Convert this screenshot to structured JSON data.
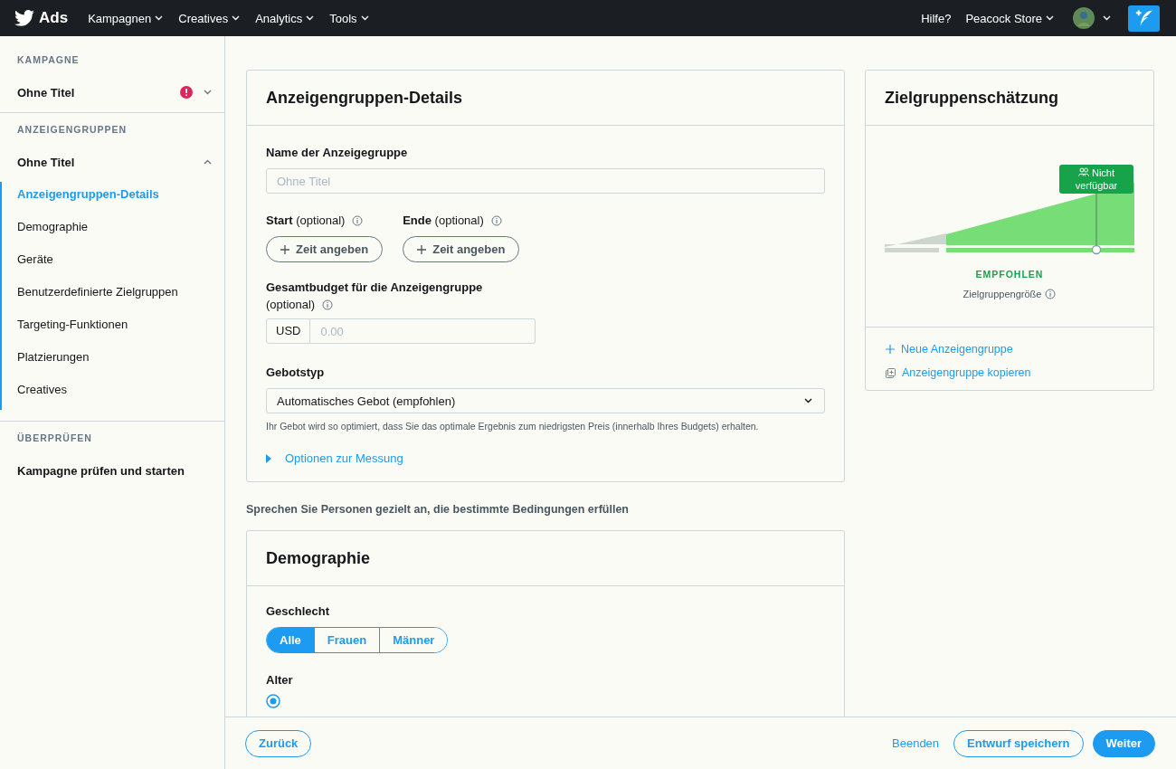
{
  "topbar": {
    "brand": "Ads",
    "nav": [
      {
        "label": "Kampagnen"
      },
      {
        "label": "Creatives"
      },
      {
        "label": "Analytics"
      },
      {
        "label": "Tools"
      }
    ],
    "help": "Hilfe?",
    "account": "Peacock Store"
  },
  "sidebar": {
    "sections": [
      {
        "heading": "KAMPAGNE",
        "title": "Ohne Titel",
        "error": true,
        "expanded": false
      },
      {
        "heading": "ANZEIGENGRUPPEN",
        "title": "Ohne Titel",
        "error": false,
        "expanded": true,
        "items": [
          {
            "label": "Anzeigengruppen-Details",
            "selected": true
          },
          {
            "label": "Demographie",
            "selected": false
          },
          {
            "label": "Geräte",
            "selected": false
          },
          {
            "label": "Benutzerdefinierte Zielgruppen",
            "selected": false
          },
          {
            "label": "Targeting-Funktionen",
            "selected": false
          },
          {
            "label": "Platzierungen",
            "selected": false
          },
          {
            "label": "Creatives",
            "selected": false
          }
        ]
      },
      {
        "heading": "ÜBERPRÜFEN",
        "title": "Kampagne prüfen und starten",
        "error": false
      }
    ]
  },
  "details": {
    "title": "Anzeigengruppen-Details",
    "name_label": "Name der Anzeigegruppe",
    "name_placeholder": "Ohne Titel",
    "start": {
      "label": "**Start** (optional)",
      "button": "Zeit angeben"
    },
    "end": {
      "label": "**Ende** (optional)",
      "button": "Zeit angeben"
    },
    "budget_label": "Gesamtbudget für die Anzeigengruppe",
    "budget_optional": "(optional)",
    "currency": "USD",
    "budget_placeholder": "0.00",
    "bid_label": "Gebotstyp",
    "bid_value": "Automatisches Gebot (empfohlen)",
    "bid_hint": "Ihr Gebot wird so optimiert, dass Sie das optimale Ergebnis zum niedrigsten Preis (innerhalb Ihres Budgets) erhalten.",
    "measure": {
      "label": "Optionen zur Messung",
      "expanded": false
    }
  },
  "intro": "Sprechen Sie Personen gezielt an, die bestimmte Bedingungen erfüllen",
  "demographics": {
    "title": "Demographie",
    "gender_label": "Geschlecht",
    "genders": [
      {
        "label": "Alle",
        "selected": true
      },
      {
        "label": "Frauen",
        "selected": false
      },
      {
        "label": "Männer",
        "selected": false
      }
    ],
    "age_label": "Alter",
    "age_all_selected": true
  },
  "estimate": {
    "title": "Zielgruppenschätzung",
    "tooltip": "Nicht verfügbar",
    "recommendation": "EMPFOHLEN",
    "size_label": "Zielgruppengröße",
    "actions": [
      {
        "kind": "new",
        "label": "Neue Anzeigengruppe"
      },
      {
        "kind": "copy",
        "label": "Anzeigengruppe kopieren"
      }
    ]
  },
  "footer": {
    "back": "Zurück",
    "finish": "Beenden",
    "save": "Entwurf speichern",
    "next": "Weiter"
  }
}
